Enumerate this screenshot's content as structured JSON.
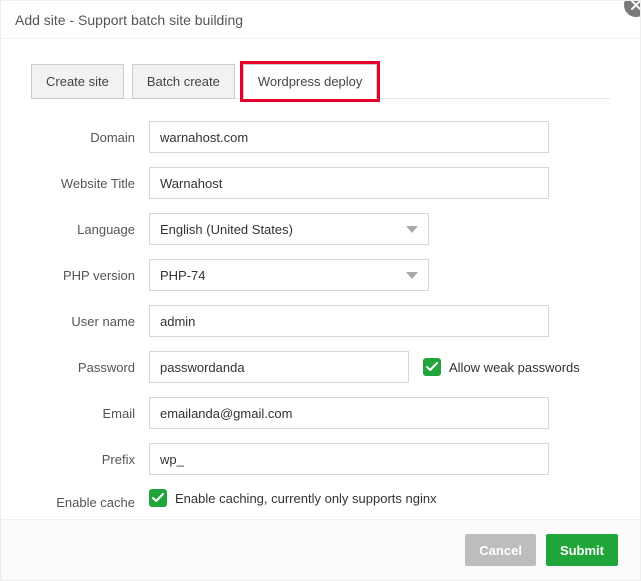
{
  "title": "Add site - Support batch site building",
  "tabs": {
    "create": "Create site",
    "batch": "Batch create",
    "wp": "Wordpress deploy"
  },
  "labels": {
    "domain": "Domain",
    "website_title": "Website Title",
    "language": "Language",
    "php_version": "PHP version",
    "user_name": "User name",
    "password": "Password",
    "email": "Email",
    "prefix": "Prefix",
    "enable_cache": "Enable cache"
  },
  "values": {
    "domain": "warnahost.com",
    "website_title": "Warnahost",
    "language": "English (United States)",
    "php_version": "PHP-74",
    "user_name": "admin",
    "password": "passwordanda",
    "email": "emailanda@gmail.com",
    "prefix": "wp_"
  },
  "checkbox": {
    "allow_weak": "Allow weak passwords",
    "cache_text": "Enable caching, currently only supports nginx"
  },
  "footer": {
    "cancel": "Cancel",
    "submit": "Submit"
  }
}
